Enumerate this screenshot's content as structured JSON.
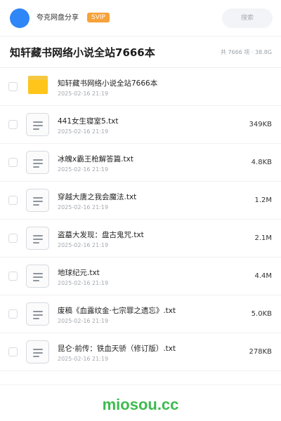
{
  "header": {
    "username": "夸克网盘分享",
    "badge": "SVIP",
    "search_placeholder": "搜索",
    "avatar_color": "#2f86f6",
    "badge_color": "#f7a23a"
  },
  "title_bar": {
    "title": "知轩藏书网络小说全站7666本",
    "summary": "共 7666 项 · 38.8G"
  },
  "files": [
    {
      "name": "知轩藏书网络小说全站7666本",
      "date": "2025-02-16 21:19",
      "size": "",
      "icon": "folder-icon"
    },
    {
      "name": "441女生寝室5.txt",
      "date": "2025-02-16 21:19",
      "size": "349KB",
      "icon": "document-icon"
    },
    {
      "name": "冰魄x霸王枪解答篇.txt",
      "date": "2025-02-16 21:19",
      "size": "4.8KB",
      "icon": "document-icon"
    },
    {
      "name": "穿越大唐之我会魔法.txt",
      "date": "2025-02-16 21:19",
      "size": "1.2M",
      "icon": "document-icon"
    },
    {
      "name": "盗墓大发现：盘古鬼咒.txt",
      "date": "2025-02-16 21:19",
      "size": "2.1M",
      "icon": "document-icon"
    },
    {
      "name": "地球纪元.txt",
      "date": "2025-02-16 21:19",
      "size": "4.4M",
      "icon": "document-icon"
    },
    {
      "name": "废稿《血露纹金·七宗罪之遗忘》.txt",
      "date": "2025-02-16 21:19",
      "size": "5.0KB",
      "icon": "document-icon"
    },
    {
      "name": "昆仑·前传：铁血天骄（修订版）.txt",
      "date": "2025-02-16 21:19",
      "size": "278KB",
      "icon": "document-icon"
    }
  ],
  "footer": {
    "watermark": "miosou.cc",
    "watermark_color": "#3dbb4f"
  }
}
